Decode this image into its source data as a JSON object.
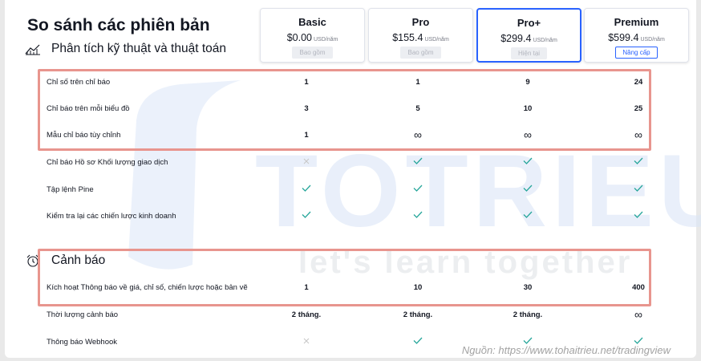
{
  "page": {
    "title": "So sánh các phiên bản"
  },
  "plans": [
    {
      "name": "Basic",
      "price": "$0.00",
      "unit": "USD/năm",
      "button": "Bao gồm",
      "state": "included"
    },
    {
      "name": "Pro",
      "price": "$155.4",
      "unit": "USD/năm",
      "button": "Bao gồm",
      "state": "included"
    },
    {
      "name": "Pro+",
      "price": "$299.4",
      "unit": "USD/năm",
      "button": "Hiện tại",
      "state": "current"
    },
    {
      "name": "Premium",
      "price": "$599.4",
      "unit": "USD/năm",
      "button": "Nâng cấp",
      "state": "upgrade"
    }
  ],
  "sections": {
    "analysis": {
      "title": "Phân tích kỹ thuật và thuật toán",
      "icon": "chart-analysis-icon",
      "rows": [
        {
          "label": "Chỉ số trên chỉ báo",
          "values": [
            "1",
            "1",
            "9",
            "24"
          ]
        },
        {
          "label": "Chỉ báo trên mỗi biểu đồ",
          "values": [
            "3",
            "5",
            "10",
            "25"
          ]
        },
        {
          "label": "Mẫu chỉ báo tùy chỉnh",
          "values": [
            "1",
            "∞",
            "∞",
            "∞"
          ]
        },
        {
          "label": "Chỉ báo Hồ sơ Khối lượng giao dịch",
          "values": [
            "cross",
            "check",
            "check",
            "check"
          ]
        },
        {
          "label": "Tập lệnh Pine",
          "values": [
            "check",
            "check",
            "check",
            "check"
          ]
        },
        {
          "label": "Kiểm tra lại các chiến lược kinh doanh",
          "values": [
            "check",
            "check",
            "check",
            "check"
          ]
        }
      ]
    },
    "alerts": {
      "title": "Cảnh báo",
      "icon": "alarm-clock-icon",
      "rows": [
        {
          "label": "Kích hoạt Thông báo về giá, chỉ số, chiến lược hoặc bản vẽ",
          "values": [
            "1",
            "10",
            "30",
            "400"
          ]
        },
        {
          "label": "Thời lượng cảnh báo",
          "values": [
            "2 tháng.",
            "2 tháng.",
            "2 tháng.",
            "∞"
          ]
        },
        {
          "label": "Thông báo Webhook",
          "values": [
            "cross",
            "check",
            "check",
            "check"
          ]
        }
      ]
    }
  },
  "watermark": {
    "brand": "TOTRIEU",
    "tagline": "let's learn together"
  },
  "source": "Nguồn: https://www.tohaitrieu.net/tradingview",
  "colors": {
    "accent": "#2962ff",
    "check": "#26a69a",
    "cross": "#c8c8c8",
    "highlight": "#e8958e",
    "watermark": "#dbe6f7"
  }
}
